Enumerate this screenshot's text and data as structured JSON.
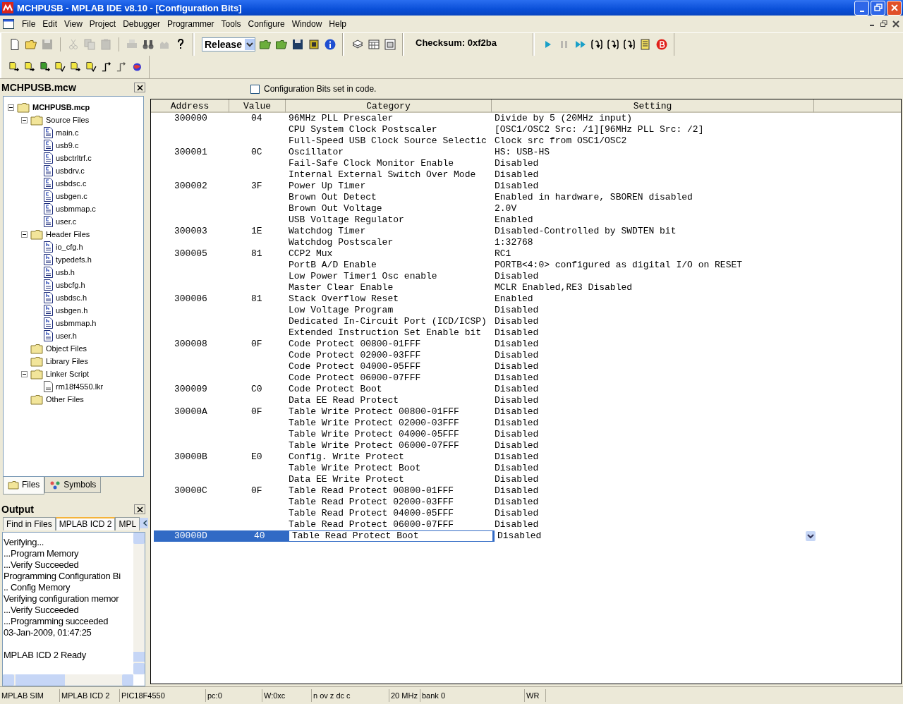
{
  "window": {
    "title": "MCHPUSB - MPLAB IDE v8.10 - [Configuration Bits]"
  },
  "menu": [
    "File",
    "Edit",
    "View",
    "Project",
    "Debugger",
    "Programmer",
    "Tools",
    "Configure",
    "Window",
    "Help"
  ],
  "toolbar": {
    "build_config": "Release",
    "checksum": "Checksum: 0xf2ba"
  },
  "workspace": {
    "title": "MCHPUSB.mcw",
    "tree": [
      {
        "label": "MCHPUSB.mcp",
        "kind": "project",
        "expanded": true,
        "children": [
          {
            "label": "Source Files",
            "kind": "folder",
            "expanded": true,
            "children": [
              {
                "label": "main.c",
                "kind": "c"
              },
              {
                "label": "usb9.c",
                "kind": "c"
              },
              {
                "label": "usbctrltrf.c",
                "kind": "c"
              },
              {
                "label": "usbdrv.c",
                "kind": "c"
              },
              {
                "label": "usbdsc.c",
                "kind": "c"
              },
              {
                "label": "usbgen.c",
                "kind": "c"
              },
              {
                "label": "usbmmap.c",
                "kind": "c"
              },
              {
                "label": "user.c",
                "kind": "c"
              }
            ]
          },
          {
            "label": "Header Files",
            "kind": "folder",
            "expanded": true,
            "children": [
              {
                "label": "io_cfg.h",
                "kind": "h"
              },
              {
                "label": "typedefs.h",
                "kind": "h"
              },
              {
                "label": "usb.h",
                "kind": "h"
              },
              {
                "label": "usbcfg.h",
                "kind": "h"
              },
              {
                "label": "usbdsc.h",
                "kind": "h"
              },
              {
                "label": "usbgen.h",
                "kind": "h"
              },
              {
                "label": "usbmmap.h",
                "kind": "h"
              },
              {
                "label": "user.h",
                "kind": "h"
              }
            ]
          },
          {
            "label": "Object Files",
            "kind": "folder"
          },
          {
            "label": "Library Files",
            "kind": "folder"
          },
          {
            "label": "Linker Script",
            "kind": "folder",
            "expanded": true,
            "children": [
              {
                "label": "rm18f4550.lkr",
                "kind": "file"
              }
            ]
          },
          {
            "label": "Other Files",
            "kind": "folder"
          }
        ]
      }
    ],
    "tabs": [
      {
        "label": "Files",
        "kind": "folder",
        "selected": true
      },
      {
        "label": "Symbols",
        "kind": "symbols",
        "selected": false
      }
    ]
  },
  "output": {
    "title": "Output",
    "tabs": [
      {
        "label": "Find in Files",
        "selected": false
      },
      {
        "label": "MPLAB ICD 2",
        "selected": true
      },
      {
        "label": "MPL",
        "selected": false
      }
    ],
    "lines": [
      {
        "text": "Verifying..."
      },
      {
        "text": "...Program Memory"
      },
      {
        "text": "...Verify Succeeded"
      },
      {
        "text": "Programming Configuration Bi"
      },
      {
        "text": ".. Config Memory"
      },
      {
        "text": "Verifying configuration memor"
      },
      {
        "text": "...Verify Succeeded"
      },
      {
        "text": "...Programming succeeded"
      },
      {
        "text": "03-Jan-2009, 01:47:25"
      },
      {
        "text": "MPLAB ICD 2 Ready",
        "spaced": true
      }
    ]
  },
  "config": {
    "checkbox": {
      "label": "Configuration Bits set in code.",
      "checked": false
    },
    "columns": [
      "Address",
      "Value",
      "Category",
      "Setting"
    ],
    "rows": [
      {
        "address": "300000",
        "value": "04",
        "category": "96MHz PLL Prescaler",
        "setting": "Divide by 5 (20MHz input)",
        "selected": false
      },
      {
        "category": "CPU System Clock Postscaler",
        "setting": "[OSC1/OSC2 Src: /1][96MHz PLL Src: /2]",
        "selected": false
      },
      {
        "category": "Full-Speed USB Clock Source Selectic",
        "setting": "Clock src from OSC1/OSC2",
        "selected": false
      },
      {
        "address": "300001",
        "value": "0C",
        "category": "Oscillator",
        "setting": "HS: USB-HS",
        "selected": false
      },
      {
        "category": "Fail-Safe Clock Monitor Enable",
        "setting": "Disabled",
        "selected": false
      },
      {
        "category": "Internal External Switch Over Mode",
        "setting": "Disabled",
        "selected": false
      },
      {
        "address": "300002",
        "value": "3F",
        "category": "Power Up Timer",
        "setting": "Disabled",
        "selected": false
      },
      {
        "category": "Brown Out Detect",
        "setting": "Enabled in hardware, SBOREN disabled",
        "selected": false
      },
      {
        "category": "Brown Out Voltage",
        "setting": "2.0V",
        "selected": false
      },
      {
        "category": "USB Voltage Regulator",
        "setting": "Enabled",
        "selected": false
      },
      {
        "address": "300003",
        "value": "1E",
        "category": "Watchdog Timer",
        "setting": "Disabled-Controlled by SWDTEN bit",
        "selected": false
      },
      {
        "category": "Watchdog Postscaler",
        "setting": "1:32768",
        "selected": false
      },
      {
        "address": "300005",
        "value": "81",
        "category": "CCP2 Mux",
        "setting": "RC1",
        "selected": false
      },
      {
        "category": "PortB A/D Enable",
        "setting": "PORTB<4:0> configured as digital I/O on RESET",
        "selected": false
      },
      {
        "category": "Low Power Timer1 Osc enable",
        "setting": "Disabled",
        "selected": false
      },
      {
        "category": "Master Clear Enable",
        "setting": "MCLR Enabled,RE3 Disabled",
        "selected": false
      },
      {
        "address": "300006",
        "value": "81",
        "category": "Stack Overflow Reset",
        "setting": "Enabled",
        "selected": false
      },
      {
        "category": "Low Voltage Program",
        "setting": "Disabled",
        "selected": false
      },
      {
        "category": "Dedicated In-Circuit Port (ICD/ICSP)",
        "setting": "Disabled",
        "selected": false
      },
      {
        "category": "Extended Instruction Set Enable bit",
        "setting": "Disabled",
        "selected": false
      },
      {
        "address": "300008",
        "value": "0F",
        "category": "Code Protect 00800-01FFF",
        "setting": "Disabled",
        "selected": false
      },
      {
        "category": "Code Protect 02000-03FFF",
        "setting": "Disabled",
        "selected": false
      },
      {
        "category": "Code Protect 04000-05FFF",
        "setting": "Disabled",
        "selected": false
      },
      {
        "category": "Code Protect 06000-07FFF",
        "setting": "Disabled",
        "selected": false
      },
      {
        "address": "300009",
        "value": "C0",
        "category": "Code Protect Boot",
        "setting": "Disabled",
        "selected": false
      },
      {
        "category": "Data EE Read Protect",
        "setting": "Disabled",
        "selected": false
      },
      {
        "address": "30000A",
        "value": "0F",
        "category": "Table Write Protect 00800-01FFF",
        "setting": "Disabled",
        "selected": false
      },
      {
        "category": "Table Write Protect 02000-03FFF",
        "setting": "Disabled",
        "selected": false
      },
      {
        "category": "Table Write Protect 04000-05FFF",
        "setting": "Disabled",
        "selected": false
      },
      {
        "category": "Table Write Protect 06000-07FFF",
        "setting": "Disabled",
        "selected": false
      },
      {
        "address": "30000B",
        "value": "E0",
        "category": "Config. Write Protect",
        "setting": "Disabled",
        "selected": false
      },
      {
        "category": "Table Write Protect Boot",
        "setting": "Disabled",
        "selected": false
      },
      {
        "category": "Data EE Write Protect",
        "setting": "Disabled",
        "selected": false
      },
      {
        "address": "30000C",
        "value": "0F",
        "category": "Table Read Protect 00800-01FFF",
        "setting": "Disabled",
        "selected": false
      },
      {
        "category": "Table Read Protect 02000-03FFF",
        "setting": "Disabled",
        "selected": false
      },
      {
        "category": "Table Read Protect 04000-05FFF",
        "setting": "Disabled",
        "selected": false
      },
      {
        "category": "Table Read Protect 06000-07FFF",
        "setting": "Disabled",
        "selected": false
      },
      {
        "address": "30000D",
        "value": "40",
        "category": "Table Read Protect Boot",
        "setting": "Disabled",
        "selected": true
      }
    ]
  },
  "status_bar": [
    "MPLAB SIM",
    "MPLAB ICD 2",
    "PIC18F4550",
    "pc:0",
    "W:0xc",
    "n ov z dc c",
    "20 MHz",
    "bank 0",
    "WR"
  ]
}
